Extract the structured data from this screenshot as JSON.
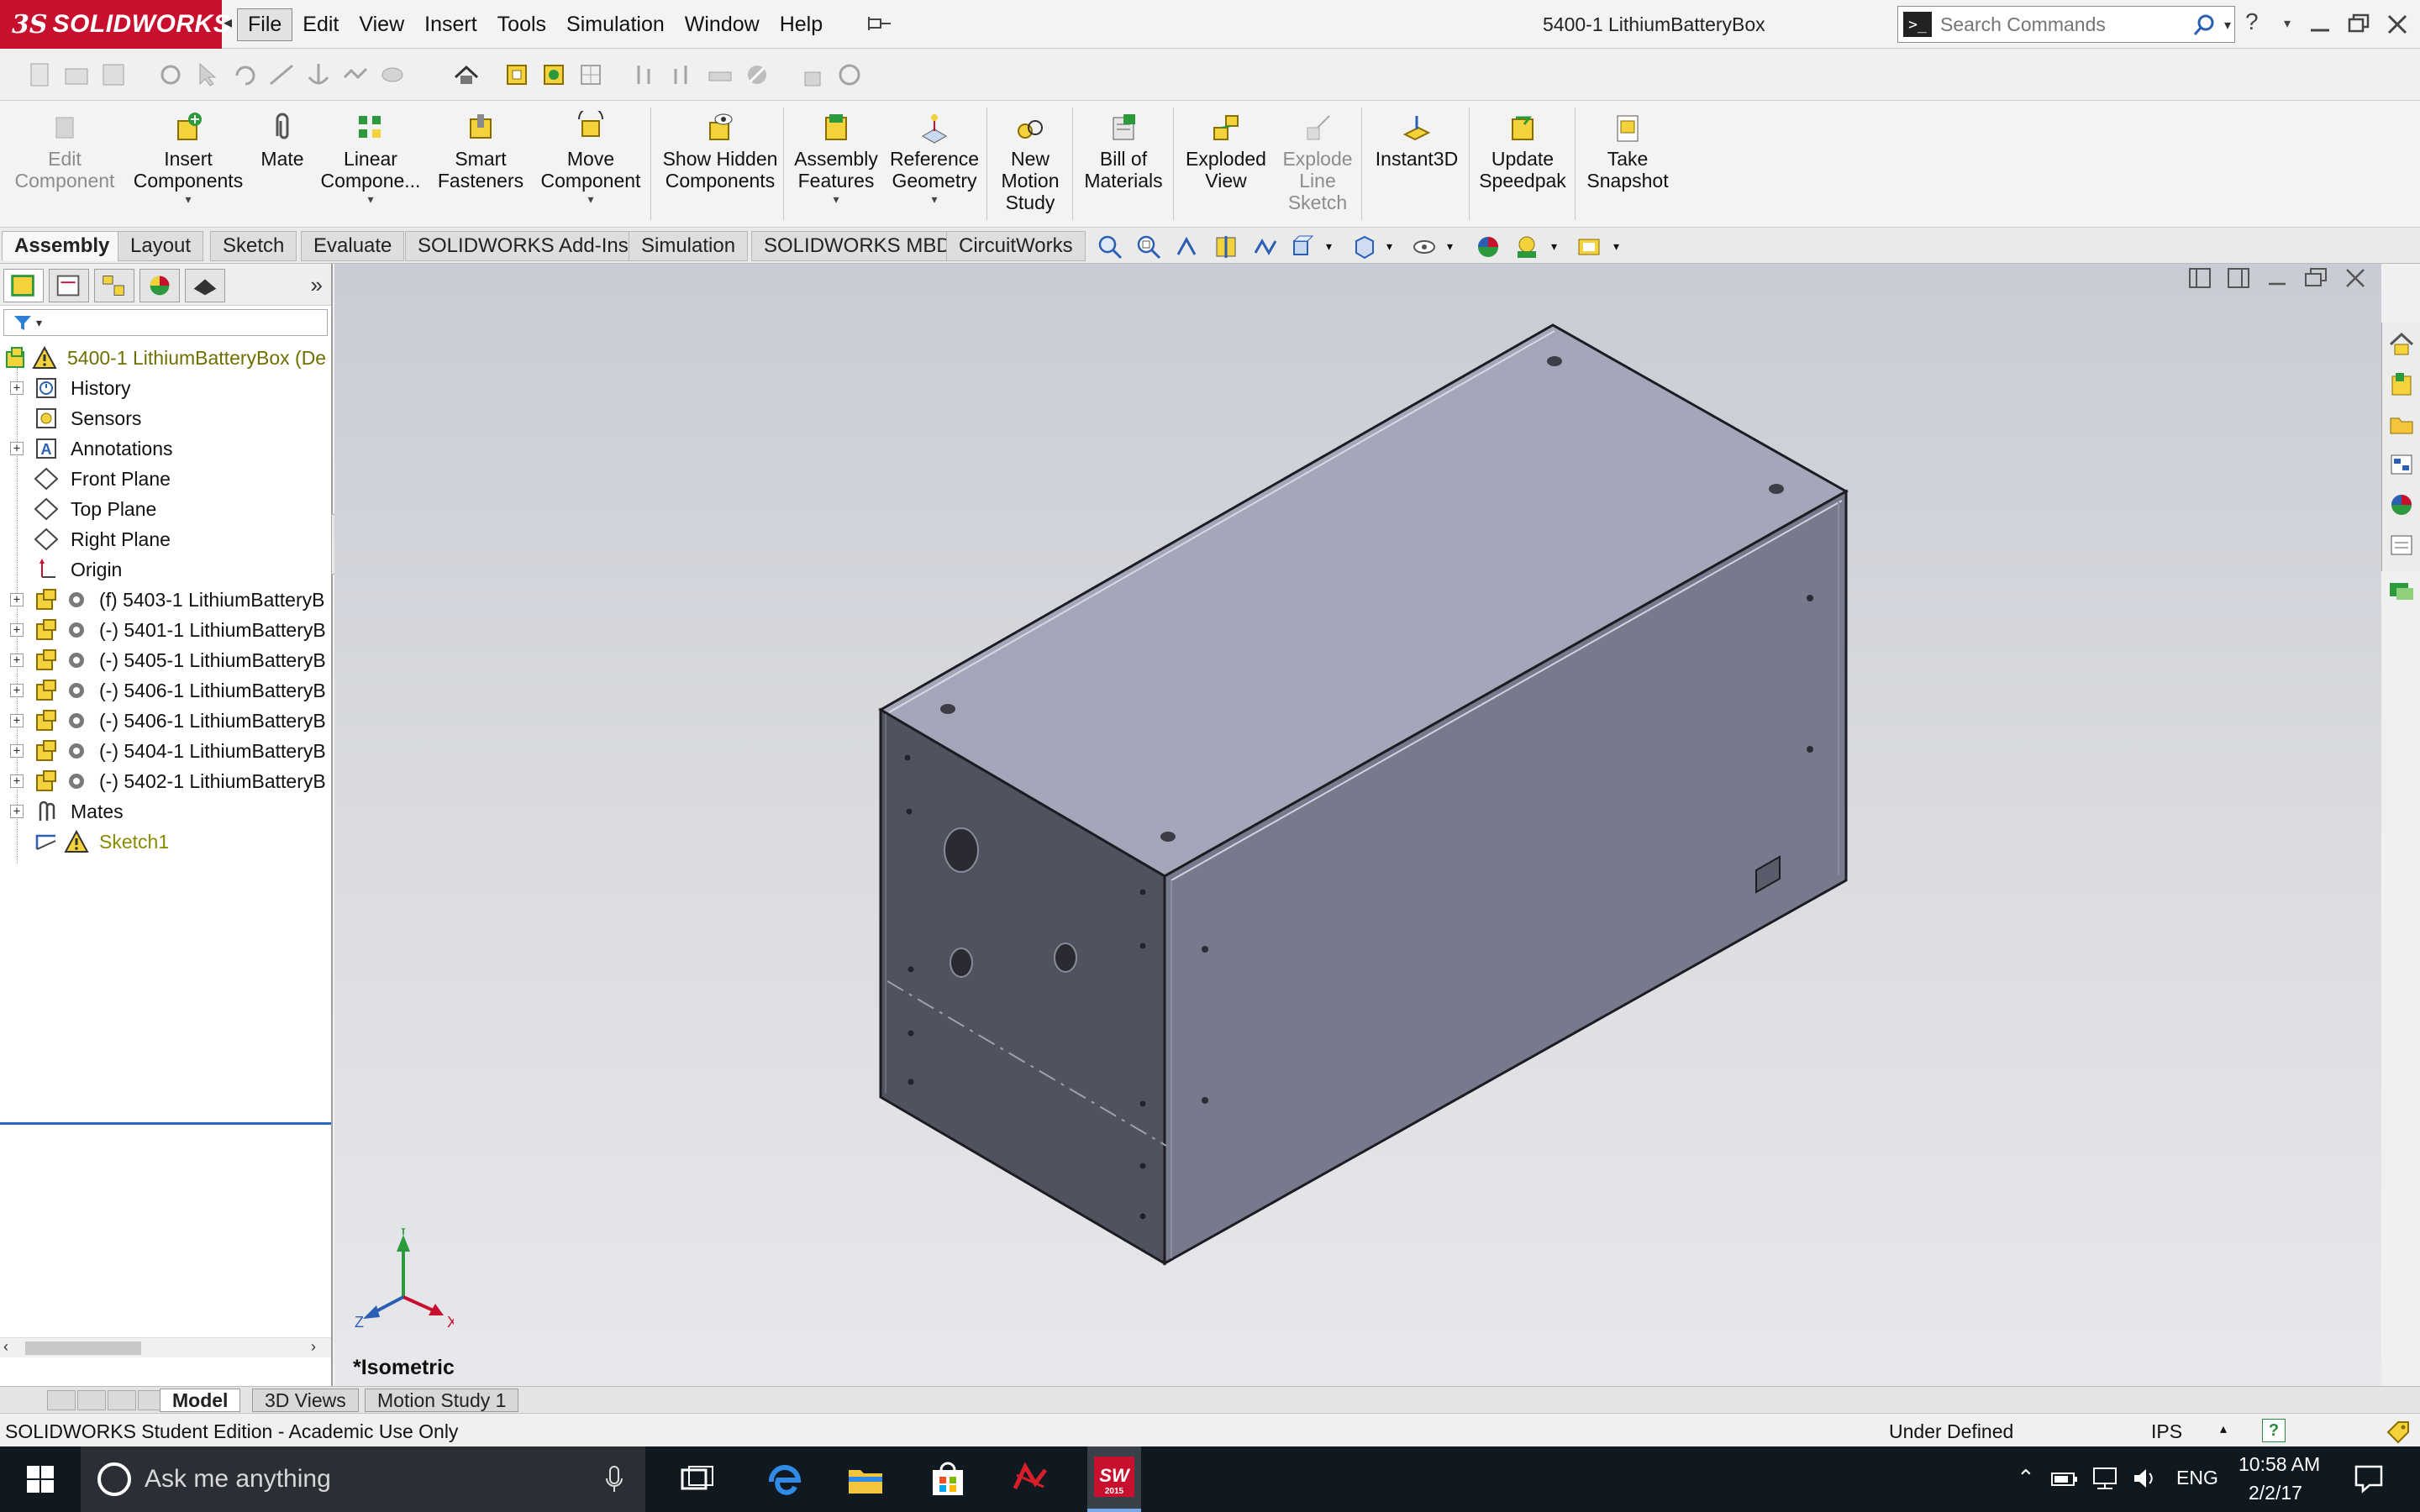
{
  "app": {
    "logo_ds": "3S",
    "logo_text": "SOLIDWORKS",
    "document_title": "5400-1 LithiumBatteryBox"
  },
  "menu": {
    "items": [
      "File",
      "Edit",
      "View",
      "Insert",
      "Tools",
      "Simulation",
      "Window",
      "Help"
    ],
    "active": "File"
  },
  "search": {
    "placeholder": "Search Commands"
  },
  "command_manager": {
    "edit_component": "Edit Component",
    "insert_components": "Insert Components",
    "mate": "Mate",
    "linear_component": "Linear Compone...",
    "smart_fasteners": "Smart Fasteners",
    "move_component": "Move Component",
    "show_hidden": "Show Hidden Components",
    "assembly_features": "Assembly Features",
    "reference_geometry": "Reference Geometry",
    "new_motion_study": "New Motion Study",
    "bill_of_materials": "Bill of Materials",
    "exploded_view": "Exploded View",
    "explode_line_sketch": "Explode Line Sketch",
    "instant3d": "Instant3D",
    "update_speedpak": "Update Speedpak",
    "take_snapshot": "Take Snapshot"
  },
  "tabs": [
    "Assembly",
    "Layout",
    "Sketch",
    "Evaluate",
    "SOLIDWORKS Add-Ins",
    "Simulation",
    "SOLIDWORKS MBD",
    "CircuitWorks"
  ],
  "active_tab": "Assembly",
  "feature_tree": {
    "root": "5400-1 LithiumBatteryBox  (De",
    "items": [
      {
        "label": "History",
        "icon": "history-icon",
        "expandable": true
      },
      {
        "label": "Sensors",
        "icon": "sensor-icon",
        "expandable": false
      },
      {
        "label": "Annotations",
        "icon": "annotation-icon",
        "expandable": true
      },
      {
        "label": "Front Plane",
        "icon": "plane-icon",
        "expandable": false
      },
      {
        "label": "Top Plane",
        "icon": "plane-icon",
        "expandable": false
      },
      {
        "label": "Right Plane",
        "icon": "plane-icon",
        "expandable": false
      },
      {
        "label": "Origin",
        "icon": "origin-icon",
        "expandable": false
      },
      {
        "label": "(f) 5403-1 LithiumBatteryB",
        "icon": "part-icon",
        "expandable": true
      },
      {
        "label": "(-) 5401-1 LithiumBatteryB",
        "icon": "part-icon",
        "expandable": true
      },
      {
        "label": "(-) 5405-1 LithiumBatteryB",
        "icon": "part-icon",
        "expandable": true
      },
      {
        "label": "(-) 5406-1 LithiumBatteryB",
        "icon": "part-icon",
        "expandable": true
      },
      {
        "label": "(-) 5406-1 LithiumBatteryB",
        "icon": "part-icon",
        "expandable": true
      },
      {
        "label": "(-) 5404-1 LithiumBatteryB",
        "icon": "part-icon",
        "expandable": true
      },
      {
        "label": "(-) 5402-1 LithiumBatteryB",
        "icon": "part-icon",
        "expandable": true
      },
      {
        "label": "Mates",
        "icon": "mates-icon",
        "expandable": true
      },
      {
        "label": "Sketch1",
        "icon": "sketch-icon",
        "expandable": false,
        "warning": true
      }
    ]
  },
  "viewport": {
    "view_name": "*Isometric",
    "triad": {
      "x": "X",
      "y": "Y",
      "z": "Z"
    }
  },
  "bottom_tabs": [
    "Model",
    "3D Views",
    "Motion Study 1"
  ],
  "active_bottom_tab": "Model",
  "status": {
    "edition": "SOLIDWORKS Student Edition - Academic Use Only",
    "definition": "Under Defined",
    "units": "IPS",
    "help": "?"
  },
  "taskbar": {
    "search_placeholder": "Ask me anything",
    "language": "ENG",
    "time": "10:58 AM",
    "date": "2/2/17",
    "sw_badge": "2015"
  },
  "colors": {
    "brand_red": "#c8102e",
    "tree_root_text": "#6f6f00",
    "taskbar_bg": "#101820",
    "model_top": "#a5a8b8",
    "model_front": "#4f5060",
    "model_side": "#76788a"
  }
}
